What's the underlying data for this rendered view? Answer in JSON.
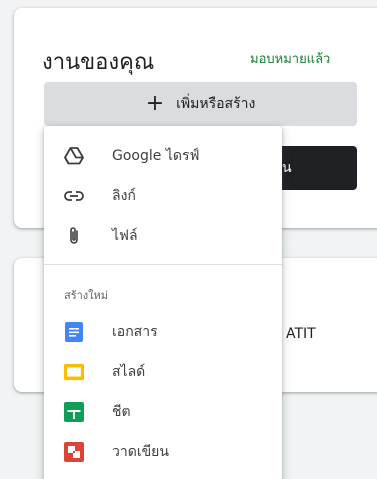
{
  "card": {
    "title": "งานของคุณ",
    "status": "มอบหมายแล้ว",
    "add_button_label": "เพิ่มหรือสร้าง",
    "dark_button_label": "น"
  },
  "second_card": {
    "course_text": "ATIT"
  },
  "menu": {
    "attach_items": [
      {
        "label": "Google ไดรฟ์",
        "icon": "google-drive-icon"
      },
      {
        "label": "ลิงก์",
        "icon": "link-icon"
      },
      {
        "label": "ไฟล์",
        "icon": "paperclip-icon"
      }
    ],
    "create_header": "สร้างใหม่",
    "create_items": [
      {
        "label": "เอกสาร",
        "icon": "google-docs-icon",
        "color": "#4285f4"
      },
      {
        "label": "สไลด์",
        "icon": "google-slides-icon",
        "color": "#fbbc04"
      },
      {
        "label": "ชีต",
        "icon": "google-sheets-icon",
        "color": "#0f9d58"
      },
      {
        "label": "วาดเขียน",
        "icon": "google-drawings-icon",
        "color": "#db4437"
      }
    ]
  }
}
